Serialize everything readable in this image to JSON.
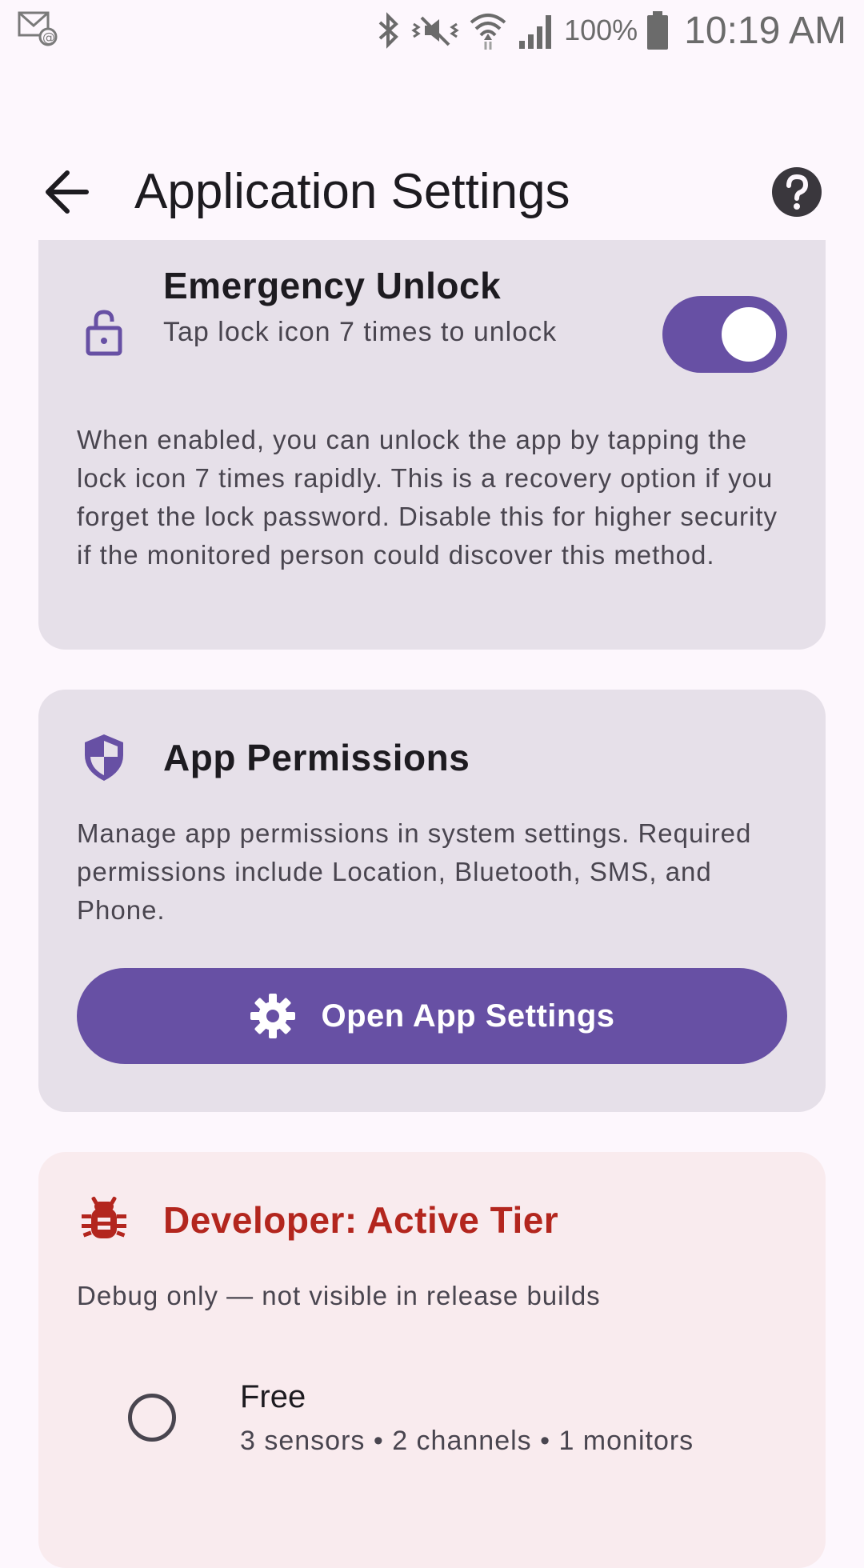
{
  "status_bar": {
    "battery_percent": "100%",
    "time": "10:19 AM",
    "icons": [
      "mail-notification-icon",
      "bluetooth-icon",
      "mute-vibrate-icon",
      "wifi-icon",
      "signal-icon",
      "battery-icon"
    ]
  },
  "header": {
    "title": "Application Settings",
    "back_icon": "arrow-back-icon",
    "help_icon": "help-icon"
  },
  "emergency_unlock": {
    "title": "Emergency Unlock",
    "subtitle": "Tap lock icon 7 times to unlock",
    "description": "When enabled, you can unlock the app by tapping the lock icon 7 times rapidly. This is a recovery option if you forget the lock password. Disable this for higher security if the monitored person could discover this method.",
    "enabled": true,
    "icon": "lock-open-icon"
  },
  "app_permissions": {
    "title": "App Permissions",
    "description": "Manage app permissions in system settings. Required permissions include Location, Bluetooth, SMS, and Phone.",
    "button_label": "Open App Settings",
    "icon": "shield-icon",
    "button_icon": "gear-icon"
  },
  "developer": {
    "title": "Developer: Active Tier",
    "subtitle": "Debug only — not visible in release builds",
    "icon": "bug-icon",
    "tiers": [
      {
        "title": "Free",
        "detail": "3 sensors • 2 channels • 1 monitors",
        "selected": false
      }
    ]
  },
  "colors": {
    "primary": "#6750A4",
    "background": "#FDF7FD",
    "card": "#E6E0E9",
    "dev_card": "#F9EBEE",
    "error": "#B3261E"
  }
}
